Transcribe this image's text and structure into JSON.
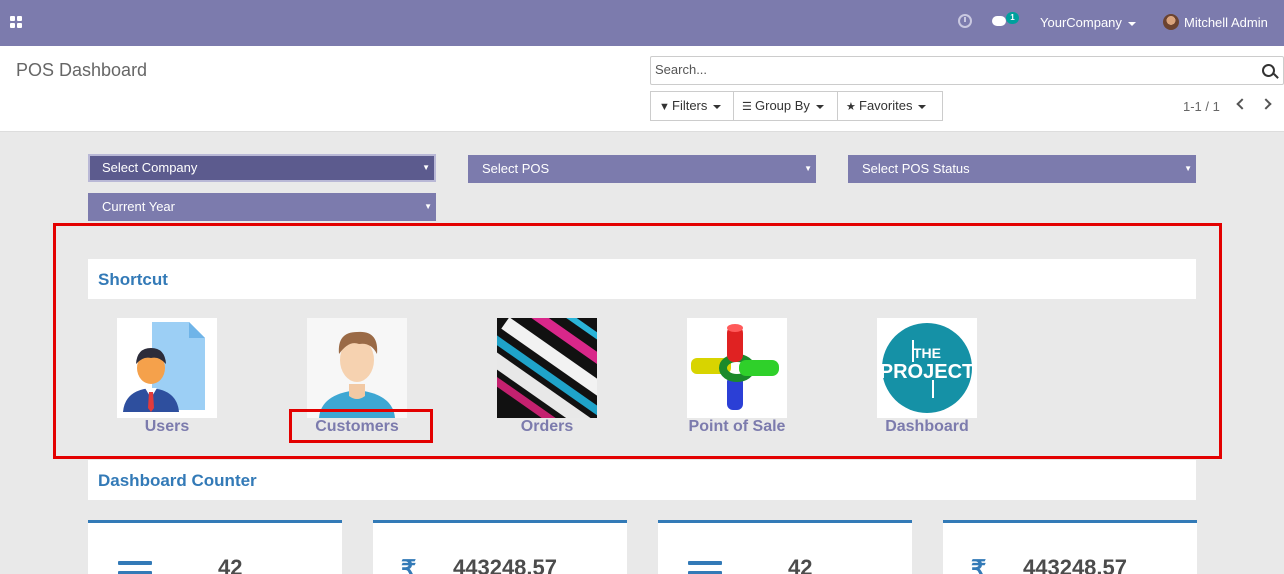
{
  "navbar": {
    "notification_count": "1",
    "company": "YourCompany",
    "user": "Mitchell Admin",
    "bg_color": "#7c7bad"
  },
  "control_panel": {
    "title": "POS Dashboard",
    "search_placeholder": "Search...",
    "filters_label": "Filters",
    "groupby_label": "Group By",
    "favorites_label": "Favorites",
    "pager": "1-1 / 1"
  },
  "selects": {
    "company": "Select Company",
    "pos": "Select POS",
    "pos_status": "Select POS Status",
    "period": "Current Year"
  },
  "shortcut": {
    "title": "Shortcut",
    "items": [
      {
        "label": "Users",
        "icon": "users-icon"
      },
      {
        "label": "Customers",
        "icon": "customers-icon"
      },
      {
        "label": "Orders",
        "icon": "orders-icon"
      },
      {
        "label": "Point of Sale",
        "icon": "point-of-sale-icon"
      },
      {
        "label": "Dashboard",
        "icon": "dashboard-icon"
      }
    ]
  },
  "counter_section": {
    "title": "Dashboard Counter",
    "counters": [
      {
        "value": "42",
        "icon": "list-icon"
      },
      {
        "value": "443248.57",
        "icon": "rupee-icon"
      },
      {
        "value": "42",
        "icon": "list-icon"
      },
      {
        "value": "443248.57",
        "icon": "rupee-icon"
      }
    ]
  },
  "colors": {
    "accent": "#7c7bad",
    "heading": "#337ab7",
    "highlight": "#e30000"
  }
}
